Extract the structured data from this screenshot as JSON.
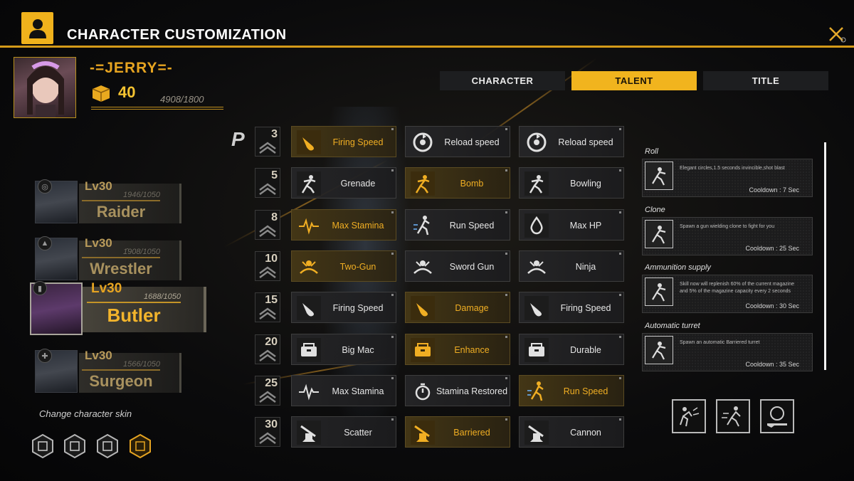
{
  "header": {
    "title": "CHARACTER CUSTOMIZATION"
  },
  "profile": {
    "name": "-=JERRY=-",
    "coins": "40",
    "xp": "4908/1800"
  },
  "tabs": [
    {
      "label": "CHARACTER",
      "active": false
    },
    {
      "label": "TALENT",
      "active": true
    },
    {
      "label": "TITLE",
      "active": false
    }
  ],
  "characters": [
    {
      "level": "Lv30",
      "xp": "1946/1050",
      "name": "Raider",
      "selected": false
    },
    {
      "level": "Lv30",
      "xp": "1̂908/1050",
      "name": "Wrestler",
      "selected": false
    },
    {
      "level": "Lv30",
      "xp": "1688/1050",
      "name": "Butler",
      "selected": true
    },
    {
      "level": "Lv30",
      "xp": "1566/1050",
      "name": "Surgeon",
      "selected": false
    }
  ],
  "change_skin_label": "Change character skin",
  "grid_marker": "P",
  "tiers": [
    "3",
    "5",
    "8",
    "10",
    "15",
    "20",
    "25",
    "30"
  ],
  "talents": [
    [
      {
        "label": "Firing Speed",
        "gold": true,
        "icon": "bullet-icon"
      },
      {
        "label": "Reload speed",
        "gold": false,
        "icon": "reload-icon"
      },
      {
        "label": "Reload speed",
        "gold": false,
        "icon": "reload-icon"
      }
    ],
    [
      {
        "label": "Grenade",
        "gold": false,
        "icon": "soldier-icon"
      },
      {
        "label": "Bomb",
        "gold": true,
        "icon": "soldier-icon"
      },
      {
        "label": "Bowling",
        "gold": false,
        "icon": "soldier-icon"
      }
    ],
    [
      {
        "label": "Max Stamina",
        "gold": true,
        "icon": "stamina-icon"
      },
      {
        "label": "Run Speed",
        "gold": false,
        "icon": "runner-icon"
      },
      {
        "label": "Max HP",
        "gold": false,
        "icon": "drop-icon"
      }
    ],
    [
      {
        "label": "Two-Gun",
        "gold": true,
        "icon": "dual-gun-icon"
      },
      {
        "label": "Sword Gun",
        "gold": false,
        "icon": "dual-gun-icon"
      },
      {
        "label": "Ninja",
        "gold": false,
        "icon": "dual-gun-icon"
      }
    ],
    [
      {
        "label": "Firing Speed",
        "gold": false,
        "icon": "bullet-icon"
      },
      {
        "label": "Damage",
        "gold": true,
        "icon": "bullet-icon"
      },
      {
        "label": "Firing Speed",
        "gold": false,
        "icon": "bullet-icon"
      }
    ],
    [
      {
        "label": "Big Mac",
        "gold": false,
        "icon": "ammo-box-icon"
      },
      {
        "label": "Enhance",
        "gold": true,
        "icon": "ammo-box-icon"
      },
      {
        "label": "Durable",
        "gold": false,
        "icon": "ammo-box-icon"
      }
    ],
    [
      {
        "label": "Max Stamina",
        "gold": false,
        "icon": "stamina-icon"
      },
      {
        "label": "Stamina Restored",
        "gold": false,
        "icon": "stopwatch-icon"
      },
      {
        "label": "Run Speed",
        "gold": true,
        "icon": "runner-icon"
      }
    ],
    [
      {
        "label": "Scatter",
        "gold": false,
        "icon": "turret-icon"
      },
      {
        "label": "Barriered",
        "gold": true,
        "icon": "turret-icon"
      },
      {
        "label": "Cannon",
        "gold": false,
        "icon": "turret-icon"
      }
    ]
  ],
  "skills": [
    {
      "title": "Roll",
      "desc": "Elegant circles,1.5 seconds invincible,shot blast",
      "cooldown": "Cooldown : 7 Sec"
    },
    {
      "title": "Clone",
      "desc": "Spawn a gun wielding clone to fight for you",
      "cooldown": "Cooldown : 25 Sec"
    },
    {
      "title": "Ammunition supply",
      "desc": "Skill now will replenish 60% of the current magazine and 5% of the magazine capacity every 2 seconds",
      "cooldown": "Cooldown : 30 Sec"
    },
    {
      "title": "Automatic turret",
      "desc": "Spawn an automatic Barriered turret",
      "cooldown": "Cooldown : 35 Sec"
    }
  ],
  "colors": {
    "accent": "#f1b41e",
    "gold_text": "#f0ae23",
    "background": "#0b0b0c"
  }
}
